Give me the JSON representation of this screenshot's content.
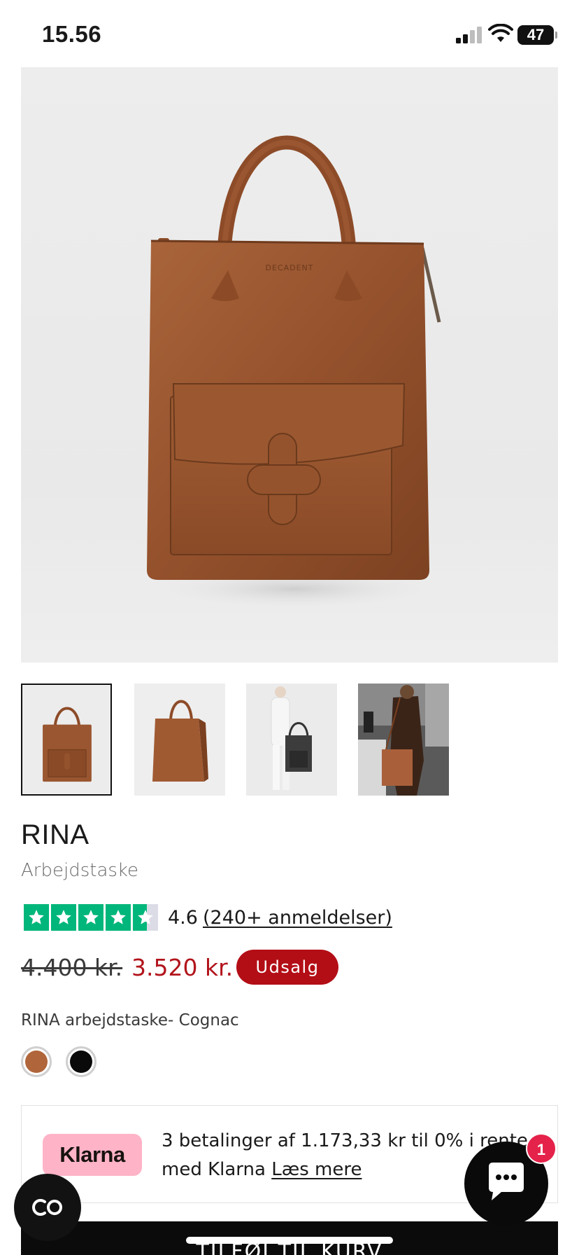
{
  "status_bar": {
    "time": "15.56",
    "battery": "47"
  },
  "product": {
    "title": "RINA",
    "subtitle": "Arbejdstaske",
    "rating": "4.6",
    "reviews_link": "(240+ anmeldelser)",
    "stars": 4.6,
    "price_old": "4.400 kr.",
    "price_new": "3.520 kr.",
    "sale_badge": "Udsalg",
    "variant_label": "RINA arbejdstaske- Cognac",
    "logo_stamp": "DECADENT",
    "swatches": [
      {
        "name": "Cognac",
        "color": "#b0653a",
        "selected": true
      },
      {
        "name": "Black",
        "color": "#0a0a0a",
        "selected": false
      }
    ]
  },
  "thumbnails": [
    {
      "icon": "bag-front-thumbnail",
      "active": true
    },
    {
      "icon": "bag-side-thumbnail",
      "active": false
    },
    {
      "icon": "model-black-bag-thumbnail",
      "active": false
    },
    {
      "icon": "model-cognac-bag-thumbnail",
      "active": false
    }
  ],
  "klarna": {
    "logo": "Klarna",
    "text": "3 betalinger af 1.173,33 kr til 0% i rente",
    "text_line2": "med Klarna",
    "link": "Læs mere"
  },
  "cart": {
    "label": "TILFØJ TIL KURV"
  },
  "chat": {
    "badge_count": "1"
  },
  "colors": {
    "sale_red": "#b30e16",
    "price_red": "#b2141c",
    "trustpilot_green": "#00b67a",
    "klarna_pink": "#ffb3c7",
    "leather": "#9a5630"
  }
}
